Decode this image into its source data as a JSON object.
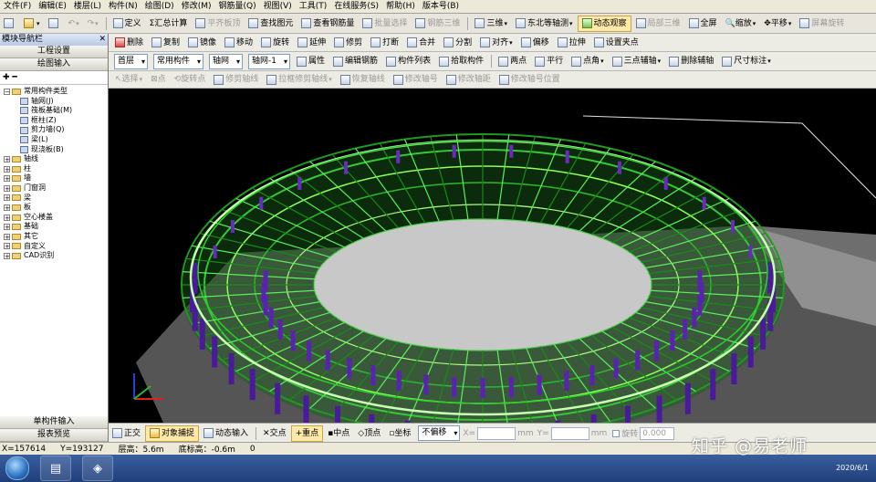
{
  "menu": [
    "文件(F)",
    "编辑(E)",
    "楼层(L)",
    "构件(N)",
    "绘图(D)",
    "修改(M)",
    "钢筋量(Q)",
    "视图(V)",
    "工具(T)",
    "在线服务(S)",
    "帮助(H)",
    "版本号(B)"
  ],
  "toolbar1": {
    "define": "定义",
    "sum_calc": "汇总计算",
    "flat_calc": "平齐板顶",
    "find": "查找图元",
    "view_rebar": "查看钢筋量",
    "batch_select": "批量选择",
    "rebar_3d": "钢筋三维",
    "view3d": "三维",
    "axon": "东北等轴测",
    "dynamic": "动态观察",
    "local3d": "局部三维",
    "fullscreen": "全屏",
    "zoom": "缩放",
    "pan": "平移",
    "screen_rotate": "屏幕旋转"
  },
  "toolbar2": [
    "删除",
    "复制",
    "镜像",
    "移动",
    "旋转",
    "延伸",
    "修剪",
    "打断",
    "合并",
    "分割",
    "对齐",
    "偏移",
    "拉伸",
    "设置夹点"
  ],
  "toolbar3": {
    "floor": "首层",
    "category": "常用构件",
    "type": "轴网",
    "name": "轴网-1",
    "props": "属性",
    "edit_rebar": "编辑钢筋",
    "comp_list": "构件列表",
    "pick": "拾取构件",
    "two_point": "两点",
    "parallel": "平行",
    "point_angle": "点角",
    "three_point": "三点辅轴",
    "del_aux": "删除辅轴",
    "dimension": "尺寸标注"
  },
  "toolbar4": [
    "选择",
    "点",
    "旋转点",
    "修剪轴线",
    "拉框修剪轴线",
    "恢复轴线",
    "修改轴号",
    "修改轴距",
    "修改轴号位置"
  ],
  "left_panel": {
    "title": "模块导航栏",
    "btn_project": "工程设置",
    "btn_draw": "绘图输入",
    "tree_root": "常用构件类型",
    "tree_sub": [
      "轴网(J)",
      "筏板基础(M)",
      "框柱(Z)",
      "剪力墙(Q)",
      "梁(L)",
      "现浇板(B)"
    ],
    "tree_folders": [
      "轴线",
      "柱",
      "墙",
      "门窗洞",
      "梁",
      "板",
      "空心楼盖",
      "基础",
      "其它",
      "自定义",
      "CAD识别"
    ],
    "btn_single": "单构件输入",
    "btn_report": "报表预览"
  },
  "snapbar": {
    "ortho": "正交",
    "obj_snap": "对象捕捉",
    "dyn_input": "动态输入",
    "cross": "交点",
    "midpoint": "重点",
    "center": "中点",
    "vertex": "顶点",
    "coord": "坐标",
    "no_offset": "不偏移",
    "x": "X=",
    "mm": "mm",
    "y": "Y=",
    "rotate": "旋转",
    "rot_value": "0.000"
  },
  "status": {
    "x": "X=157614",
    "y": "Y=193127",
    "floor_h": "层高：5.6m",
    "bottom_h": "底标高：-0.6m",
    "zero": "0"
  },
  "taskbar": {
    "date": "2020/6/1"
  },
  "watermark": "知乎 @易老师"
}
